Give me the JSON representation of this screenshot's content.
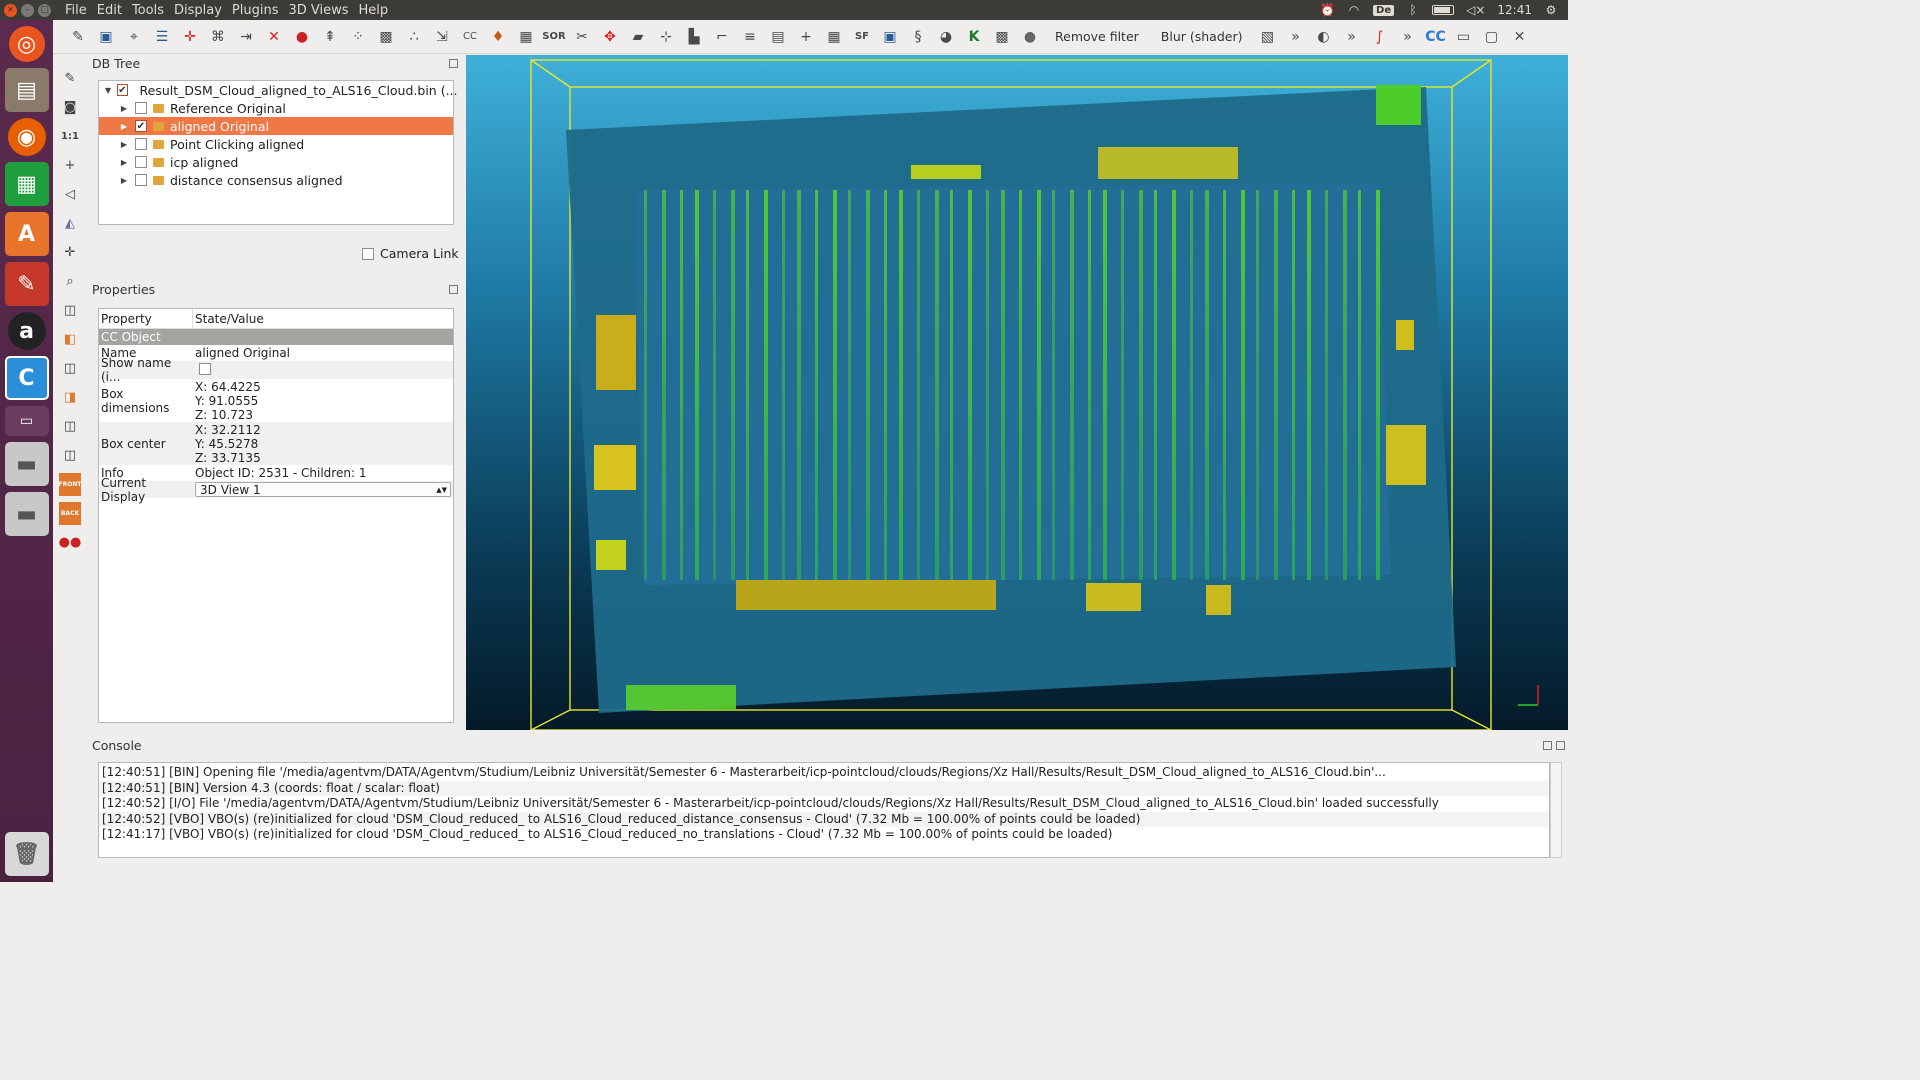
{
  "menubar": {
    "items": [
      "File",
      "Edit",
      "Tools",
      "Display",
      "Plugins",
      "3D Views",
      "Help"
    ],
    "keyboard_layout": "De",
    "clock": "12:41"
  },
  "toolbar": {
    "remove_filter": "Remove filter",
    "blur_shader": "Blur (shader)",
    "sf_icon_text": "SF",
    "sor_icon_text": "SOR",
    "cc_icon_text": "CC",
    "overflow": "»"
  },
  "vtool": {
    "one_to_one": "1:1",
    "front": "FRONT",
    "back": "BACK"
  },
  "dbtree": {
    "title": "DB Tree",
    "items": [
      {
        "label": "Result_DSM_Cloud_aligned_to_ALS16_Cloud.bin (...",
        "checked": true,
        "selected": false,
        "level": 0
      },
      {
        "label": "Reference Original",
        "checked": false,
        "selected": false,
        "level": 1
      },
      {
        "label": "aligned Original",
        "checked": true,
        "selected": true,
        "level": 1
      },
      {
        "label": "Point Clicking aligned",
        "checked": false,
        "selected": false,
        "level": 1
      },
      {
        "label": "icp aligned",
        "checked": false,
        "selected": false,
        "level": 1
      },
      {
        "label": "distance consensus aligned",
        "checked": false,
        "selected": false,
        "level": 1
      }
    ],
    "camera_link": "Camera Link"
  },
  "properties": {
    "title": "Properties",
    "col_property": "Property",
    "col_value": "State/Value",
    "section": "CC Object",
    "name_key": "Name",
    "name_val": "aligned Original",
    "showname_key": "Show name (i...",
    "boxdim_key": "Box dimensions",
    "boxdim_x": "X: 64.4225",
    "boxdim_y": "Y: 91.0555",
    "boxdim_z": "Z: 10.723",
    "boxcenter_key": "Box center",
    "boxcenter_x": "X: 32.2112",
    "boxcenter_y": "Y: 45.5278",
    "boxcenter_z": "Z: 33.7135",
    "info_key": "Info",
    "info_val": "Object ID: 2531 - Children: 1",
    "display_key": "Current Display",
    "display_val": "3D View 1"
  },
  "console": {
    "title": "Console",
    "lines": [
      "[12:40:51] [BIN] Opening file '/media/agentvm/DATA/Agentvm/Studium/Leibniz Universität/Semester 6 - Masterarbeit/icp-pointcloud/clouds/Regions/Xz Hall/Results/Result_DSM_Cloud_aligned_to_ALS16_Cloud.bin'...",
      "[12:40:51] [BIN] Version 4.3 (coords: float / scalar: float)",
      "[12:40:52] [I/O] File '/media/agentvm/DATA/Agentvm/Studium/Leibniz Universität/Semester 6 - Masterarbeit/icp-pointcloud/clouds/Regions/Xz Hall/Results/Result_DSM_Cloud_aligned_to_ALS16_Cloud.bin' loaded successfully",
      "[12:40:52] [VBO] VBO(s) (re)initialized for cloud 'DSM_Cloud_reduced_ to ALS16_Cloud_reduced_distance_consensus - Cloud' (7.32 Mb = 100.00% of points could be loaded)",
      "[12:41:17] [VBO] VBO(s) (re)initialized for cloud 'DSM_Cloud_reduced_ to ALS16_Cloud_reduced_no_translations - Cloud' (7.32 Mb = 100.00% of points could be loaded)"
    ]
  },
  "colors": {
    "accent": "#f07746",
    "bbox": "#e6e62a",
    "cloud_base": "#1f6a8a",
    "cloud_high": "#4cd42a",
    "cloud_peak": "#d8d41e"
  }
}
